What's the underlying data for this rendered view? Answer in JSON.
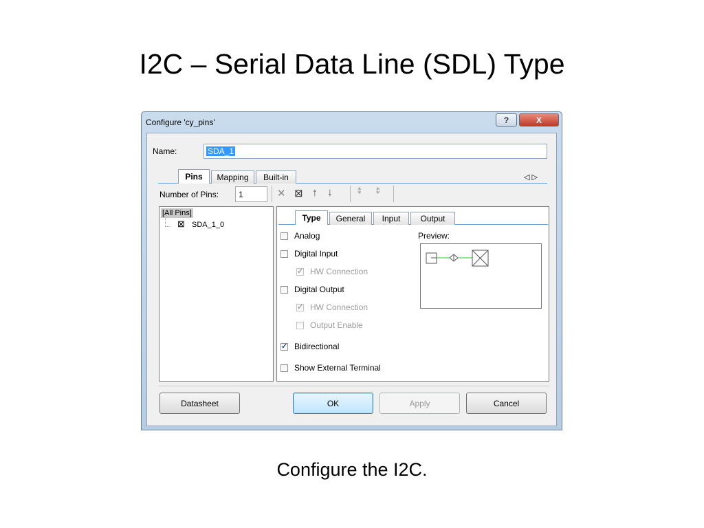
{
  "slide": {
    "title": "I2C – Serial Data Line (SDL) Type",
    "caption": "Configure the I2C."
  },
  "dialog": {
    "title": "Configure 'cy_pins'",
    "help_label": "?",
    "close_label": "X",
    "name_label": "Name:",
    "name_value": "SDA_1",
    "top_tabs": [
      "Pins",
      "Mapping",
      "Built-in"
    ],
    "active_top_tab": "Pins",
    "tab_scroll_arrows": "◁ ▷",
    "num_pins_label": "Number of Pins:",
    "num_pins_value": "1",
    "toolbar_icons": [
      "delete-icon",
      "assign-pin-icon",
      "move-up-icon",
      "move-down-icon",
      "pair-icon",
      "unpair-icon"
    ],
    "tree": {
      "root": "[All Pins]",
      "items": [
        "SDA_1_0"
      ]
    },
    "inner_tabs": [
      "Type",
      "General",
      "Input",
      "Output"
    ],
    "active_inner_tab": "Type",
    "options": {
      "analog": {
        "label": "Analog",
        "checked": false,
        "enabled": true
      },
      "digital_input": {
        "label": "Digital Input",
        "checked": false,
        "enabled": true
      },
      "di_hw_connection": {
        "label": "HW Connection",
        "checked": true,
        "enabled": false
      },
      "digital_output": {
        "label": "Digital Output",
        "checked": false,
        "enabled": true
      },
      "do_hw_connection": {
        "label": "HW Connection",
        "checked": true,
        "enabled": false
      },
      "output_enable": {
        "label": "Output Enable",
        "checked": false,
        "enabled": false
      },
      "bidirectional": {
        "label": "Bidirectional",
        "checked": true,
        "enabled": true
      },
      "show_external_terminal": {
        "label": "Show External Terminal",
        "checked": false,
        "enabled": true
      }
    },
    "preview_label": "Preview:",
    "buttons": {
      "datasheet": "Datasheet",
      "ok": "OK",
      "apply": "Apply",
      "cancel": "Cancel"
    },
    "colors": {
      "selection": "#3399ff",
      "close_button": "#c8402b",
      "preview_wire": "#22cc22"
    }
  }
}
